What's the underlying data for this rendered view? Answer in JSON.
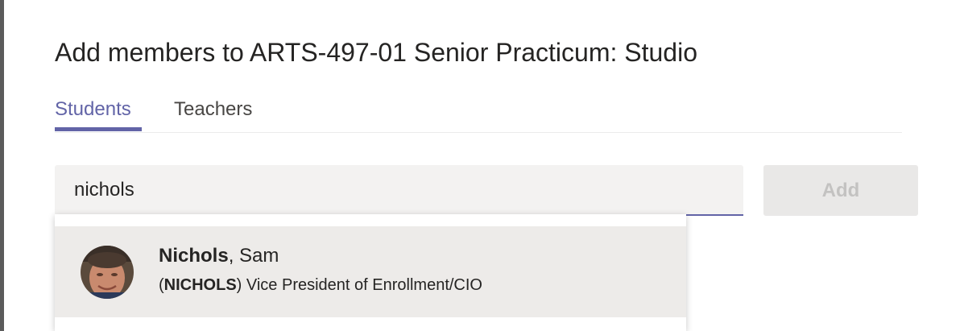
{
  "dialog": {
    "title": "Add members to ARTS-497-01 Senior Practicum: Studio"
  },
  "tabs": [
    {
      "label": "Students",
      "active": true
    },
    {
      "label": "Teachers",
      "active": false
    }
  ],
  "search": {
    "value": "nichols",
    "placeholder": ""
  },
  "add_button": {
    "label": "Add",
    "enabled": false
  },
  "suggestions": [
    {
      "surname": "Nichols",
      "given_name_suffix": ", Sam",
      "open_paren": "(",
      "user_id": "NICHOLS",
      "title_suffix": ") Vice President of Enrollment/CIO",
      "avatar_icon": "user-photo"
    }
  ],
  "colors": {
    "accent": "#6264a7",
    "disabled_button_bg": "#e9e8e7",
    "disabled_button_text": "#c3c2c1",
    "hover_row": "#edebe9",
    "input_bg": "#f3f2f1"
  }
}
